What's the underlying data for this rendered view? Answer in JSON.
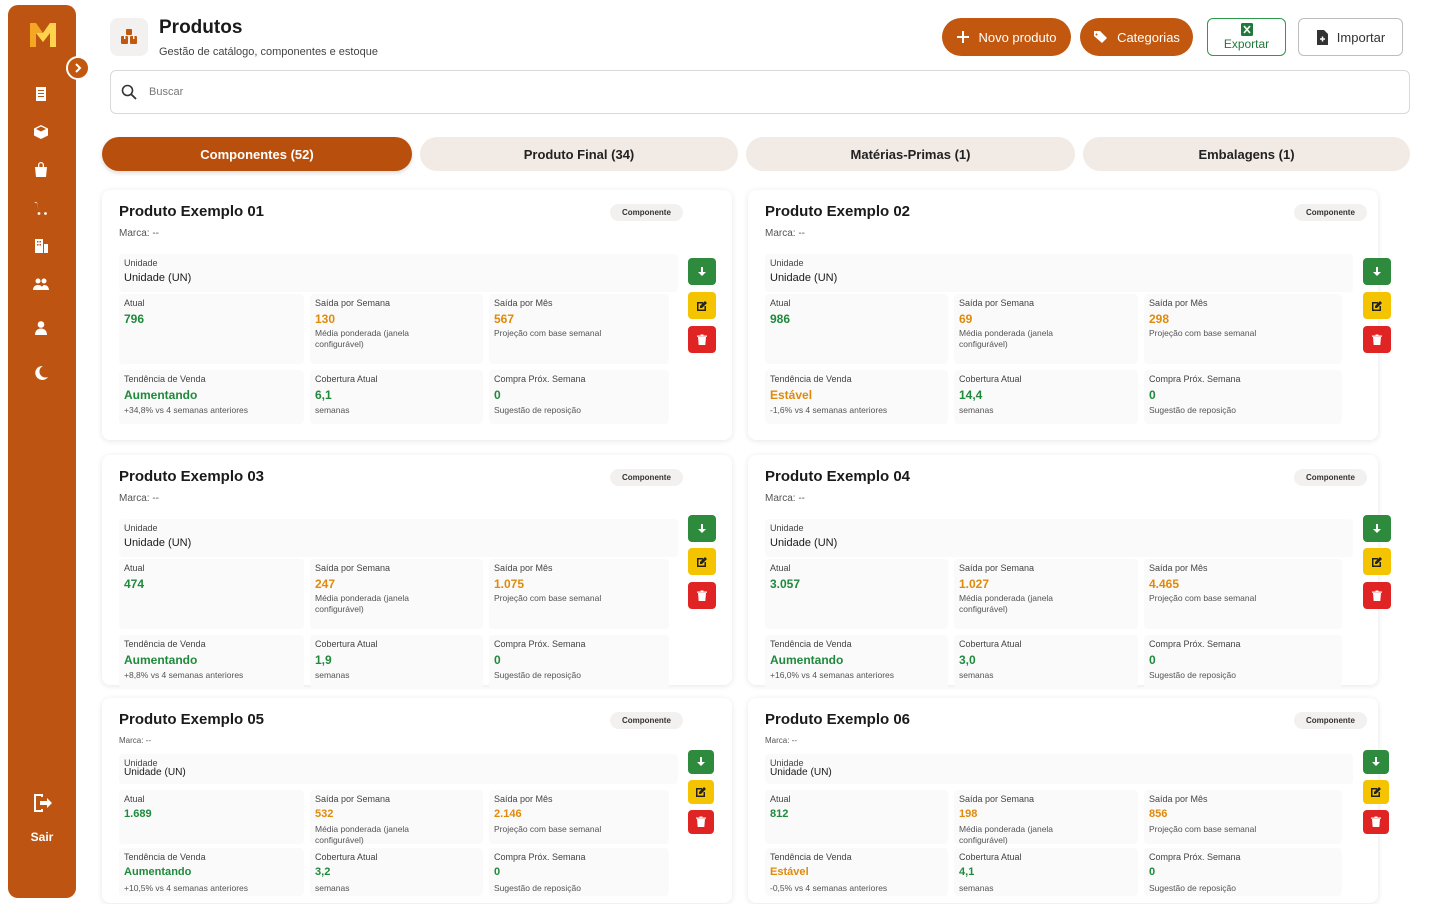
{
  "sidebar": {
    "brand_color": "#bd5411",
    "logo": "M",
    "items": [
      {
        "icon": "clipboard-icon"
      },
      {
        "icon": "box-icon"
      },
      {
        "icon": "bag-icon"
      },
      {
        "icon": "cart-icon"
      },
      {
        "icon": "building-icon"
      },
      {
        "icon": "users-icon"
      },
      {
        "icon": "person-icon"
      },
      {
        "icon": "moon-icon"
      }
    ],
    "logout_label": "Sair"
  },
  "header": {
    "title": "Produtos",
    "subtitle": "Gestão de catálogo, componentes e estoque",
    "new_product_label": "Novo produto",
    "categories_label": "Categorias",
    "export_label": "Exportar",
    "import_label": "Importar"
  },
  "search": {
    "placeholder": "Buscar"
  },
  "tabs": [
    {
      "label": "Componentes (52)",
      "active": true
    },
    {
      "label": "Produto Final (34)",
      "active": false
    },
    {
      "label": "Matérias-Primas (1)",
      "active": false
    },
    {
      "label": "Embalagens (1)",
      "active": false
    }
  ],
  "labels": {
    "unit": "Unidade",
    "current": "Atual",
    "weekly_out": "Saída por Semana",
    "weekly_out_desc": "Média ponderada (janela configurável)",
    "monthly_out": "Saída por Mês",
    "monthly_out_desc": "Projeção com base semanal",
    "trend": "Tendência de Venda",
    "coverage": "Cobertura Atual",
    "coverage_unit": "semanas",
    "next_purchase": "Compra Próx. Semana",
    "next_purchase_desc": "Sugestão de reposição"
  },
  "products": [
    {
      "name": "Produto Exemplo 01",
      "brand": "Marca: --",
      "badge": "Componente",
      "unit": "Unidade (UN)",
      "current": "796",
      "weekly": "130",
      "monthly": "567",
      "trend": "Aumentando",
      "trend_status": "up",
      "trend_desc": "+34,8% vs 4 semanas anteriores",
      "coverage": "6,1",
      "next_purchase": "0"
    },
    {
      "name": "Produto Exemplo 02",
      "brand": "Marca: --",
      "badge": "Componente",
      "unit": "Unidade (UN)",
      "current": "986",
      "weekly": "69",
      "monthly": "298",
      "trend": "Estável",
      "trend_status": "stable",
      "trend_desc": "-1,6% vs 4 semanas anteriores",
      "coverage": "14,4",
      "next_purchase": "0"
    },
    {
      "name": "Produto Exemplo 03",
      "brand": "Marca: --",
      "badge": "Componente",
      "unit": "Unidade (UN)",
      "current": "474",
      "weekly": "247",
      "monthly": "1.075",
      "trend": "Aumentando",
      "trend_status": "up",
      "trend_desc": "+8,8% vs 4 semanas anteriores",
      "coverage": "1,9",
      "next_purchase": "0"
    },
    {
      "name": "Produto Exemplo 04",
      "brand": "Marca: --",
      "badge": "Componente",
      "unit": "Unidade (UN)",
      "current": "3.057",
      "weekly": "1.027",
      "monthly": "4.465",
      "trend": "Aumentando",
      "trend_status": "up",
      "trend_desc": "+16,0% vs 4 semanas anteriores",
      "coverage": "3,0",
      "next_purchase": "0"
    },
    {
      "name": "Produto Exemplo 05",
      "brand": "Marca: --",
      "badge": "Componente",
      "unit": "Unidade (UN)",
      "current": "1.689",
      "weekly": "532",
      "monthly": "2.146",
      "trend": "Aumentando",
      "trend_status": "up",
      "trend_desc": "+10,5% vs 4 semanas anteriores",
      "coverage": "3,2",
      "next_purchase": "0"
    },
    {
      "name": "Produto Exemplo 06",
      "brand": "Marca: --",
      "badge": "Componente",
      "unit": "Unidade (UN)",
      "current": "812",
      "weekly": "198",
      "monthly": "856",
      "trend": "Estável",
      "trend_status": "stable",
      "trend_desc": "-0,5% vs 4 semanas anteriores",
      "coverage": "4,1",
      "next_purchase": "0"
    }
  ],
  "colors": {
    "accent": "#c2570f",
    "up": "#1f8a3b",
    "stable": "#e08a0b",
    "action_download": "#2e8b3e",
    "action_edit": "#f5c400",
    "action_delete": "#e02424"
  }
}
